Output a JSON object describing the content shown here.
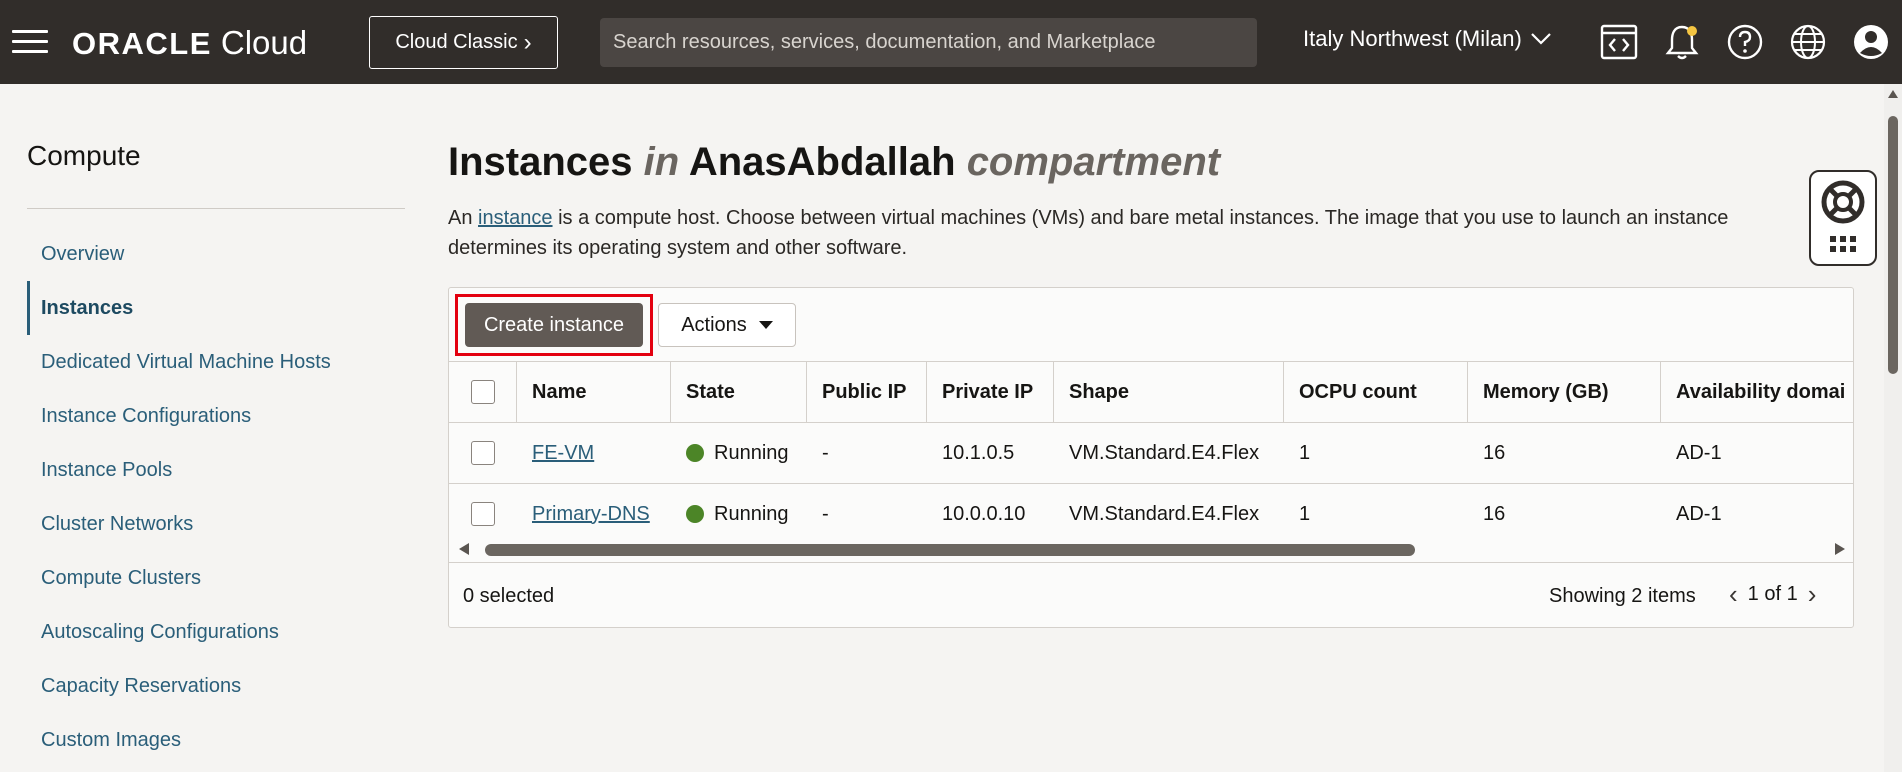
{
  "topbar": {
    "logo_oracle": "ORACLE",
    "logo_cloud": "Cloud",
    "classic_label": "Cloud Classic",
    "search_placeholder": "Search resources, services, documentation, and Marketplace",
    "region": "Italy Northwest (Milan)",
    "icons": [
      "developer-tools-icon",
      "bell-icon",
      "help-icon",
      "globe-icon",
      "user-icon"
    ]
  },
  "sidebar": {
    "title": "Compute",
    "items": [
      {
        "label": "Overview"
      },
      {
        "label": "Instances"
      },
      {
        "label": "Dedicated Virtual Machine Hosts"
      },
      {
        "label": "Instance Configurations"
      },
      {
        "label": "Instance Pools"
      },
      {
        "label": "Cluster Networks"
      },
      {
        "label": "Compute Clusters"
      },
      {
        "label": "Autoscaling Configurations"
      },
      {
        "label": "Capacity Reservations"
      },
      {
        "label": "Custom Images"
      }
    ],
    "active_item": "Instances"
  },
  "main": {
    "title_part1": "Instances",
    "title_in": "in",
    "title_compartment": "AnasAbdallah",
    "title_suffix": "compartment",
    "desc_before": "An ",
    "desc_link": "instance",
    "desc_after": " is a compute host. Choose between virtual machines (VMs) and bare metal instances. The image that you use to launch an instance determines its operating system and other software."
  },
  "toolbar": {
    "create_label": "Create instance",
    "actions_label": "Actions"
  },
  "table": {
    "columns": [
      "Name",
      "State",
      "Public IP",
      "Private IP",
      "Shape",
      "OCPU count",
      "Memory (GB)",
      "Availability domai"
    ],
    "rows": [
      {
        "name": "FE-VM",
        "state": "Running",
        "public_ip": "-",
        "private_ip": "10.1.0.5",
        "shape": "VM.Standard.E4.Flex",
        "ocpu": "1",
        "memory": "16",
        "ad": "AD-1"
      },
      {
        "name": "Primary-DNS",
        "state": "Running",
        "public_ip": "-",
        "private_ip": "10.0.0.10",
        "shape": "VM.Standard.E4.Flex",
        "ocpu": "1",
        "memory": "16",
        "ad": "AD-1"
      }
    ],
    "status_color": "#4c8527"
  },
  "footer": {
    "selected": "0 selected",
    "showing": "Showing 2 items",
    "page": "1 of 1"
  },
  "colors": {
    "topbar_bg": "#312d2a",
    "link": "#2a5e79",
    "highlight": "#e3000f",
    "primary_button": "#615a55"
  }
}
